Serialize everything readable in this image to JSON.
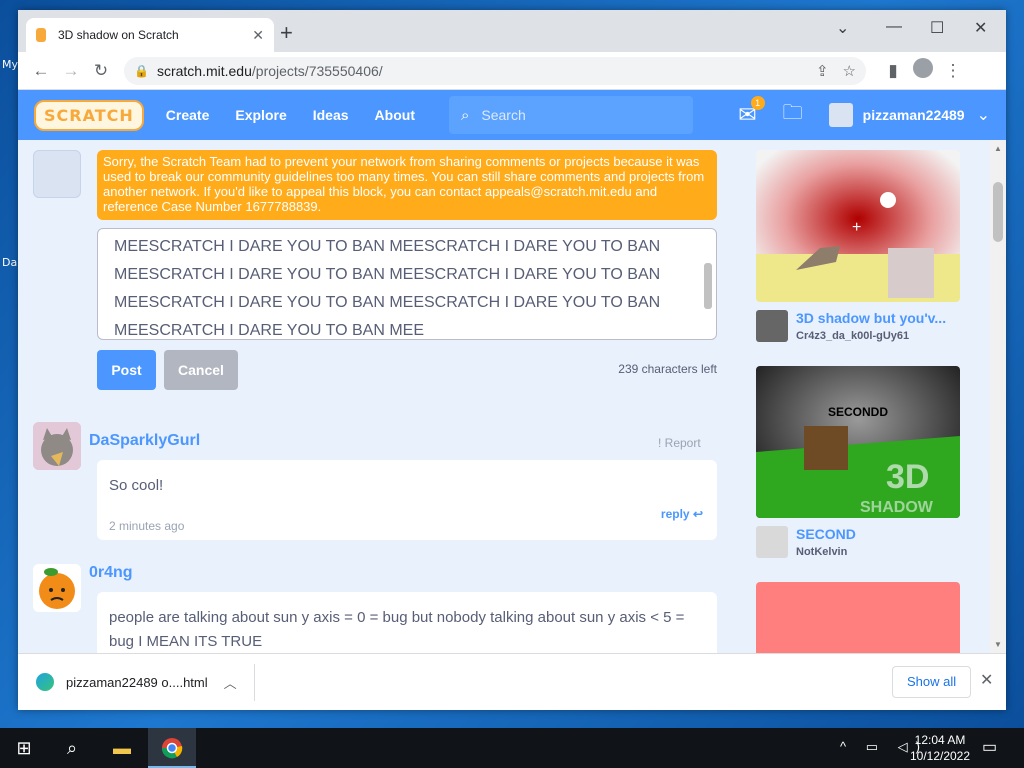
{
  "desktop": {
    "labels": [
      "My",
      "Da"
    ]
  },
  "browser": {
    "tab_title": "3D shadow on Scratch",
    "new_tab": "+",
    "url_host": "scratch.mit.edu",
    "url_path": "/projects/735550406/"
  },
  "scratch_nav": {
    "logo": "SCRATCH",
    "links": [
      "Create",
      "Explore",
      "Ideas",
      "About"
    ],
    "search_placeholder": "Search",
    "notification_count": "1",
    "username": "pizzaman22489"
  },
  "compose": {
    "warning": "Sorry, the Scratch Team had to prevent your network from sharing comments or projects because it was used to break our community guidelines too many times. You can still share comments and projects from another network. If you'd like to appeal this block, you can contact appeals@scratch.mit.edu and reference Case Number 1677788839.",
    "text_lines": [
      "MEESCRATCH I DARE YOU TO BAN MEESCRATCH I DARE YOU TO BAN",
      "MEESCRATCH I DARE YOU TO BAN MEESCRATCH I DARE YOU TO BAN",
      "MEESCRATCH I DARE YOU TO BAN MEESCRATCH I DARE YOU TO BAN",
      "MEESCRATCH I DARE YOU TO BAN MEE"
    ],
    "post_label": "Post",
    "cancel_label": "Cancel",
    "chars_left": "239 characters left"
  },
  "comments": [
    {
      "user": "DaSparklyGurl",
      "report": "Report",
      "text": "So cool!",
      "time": "2 minutes ago",
      "reply": "reply"
    },
    {
      "user": "0r4ng",
      "text": "people are talking about sun y axis = 0 = bug but nobody talking about sun y axis < 5 = bug I MEAN ITS TRUE"
    }
  ],
  "sidebar": [
    {
      "title": "3D shadow but you'v...",
      "author": "Cr4z3_da_k00l-gUy61"
    },
    {
      "image_text": "SECONDD",
      "image_text2": "3D",
      "image_text3": "SHADOW",
      "title": "SECOND",
      "author": "NotKelvin"
    }
  ],
  "downloads": {
    "file": "pizzaman22489 o....html",
    "show_all": "Show all"
  },
  "taskbar": {
    "time": "12:04 AM",
    "date": "10/12/2022"
  },
  "colors": {
    "scratch_blue": "#4c97ff",
    "warning_orange": "#ffab1a",
    "page_bg": "#e9f1fc"
  }
}
